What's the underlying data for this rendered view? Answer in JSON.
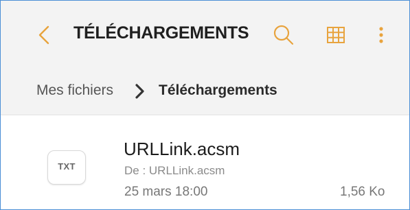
{
  "colors": {
    "accent": "#e8a33d",
    "toolbar_background": "#f3f3f3",
    "frame_border": "#4a8ed6"
  },
  "header": {
    "back_icon": "chevron-left-icon",
    "title": "TÉLÉCHARGEMENTS",
    "actions": [
      {
        "icon": "search-icon"
      },
      {
        "icon": "grid-view-icon"
      },
      {
        "icon": "more-vertical-icon"
      }
    ]
  },
  "breadcrumb": {
    "root": "Mes fichiers",
    "separator_icon": "chevron-right-icon",
    "current": "Téléchargements"
  },
  "files": [
    {
      "type_badge": "TXT",
      "name": "URLLink.acsm",
      "source": "De : URLLink.acsm",
      "date": "25 mars 18:00",
      "size": "1,56 Ko"
    }
  ]
}
